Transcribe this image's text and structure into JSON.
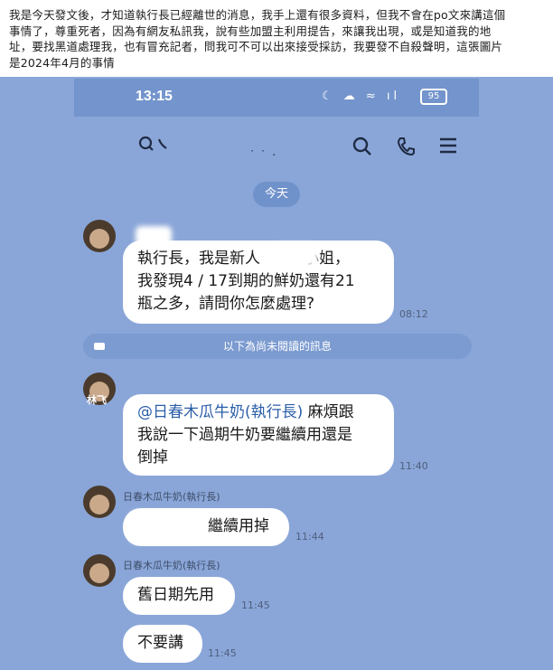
{
  "post": {
    "caption_line1": "我是今天發文後，才知道執行長已經離世的消息，我手上還有很多資料，但我不會在po文來講這個",
    "caption_line2": "事情了，尊重死者，因為有網友私訊我，說有些加盟主利用提告，來讓我出現，或是知道我的地",
    "caption_line3": "址，要找黑道處理我，也有冒充記者，問我可不可以出來接受採訪，我要發不自殺聲明，這張圖片",
    "caption_line4": "是2024年4月的事情"
  },
  "status_bar": {
    "time": "13:15",
    "battery": "95",
    "icons": "☾ ☁ ≈ ıl"
  },
  "header": {
    "name": "ᐧ ᐧ ."
  },
  "date_divider": "今天",
  "messages": [
    {
      "lines": [
        "執行長，我是新人",
        "小姐，",
        "我發現4 / 17到期的鮮奶還有21",
        "瓶之多，請問你怎麼處理?"
      ],
      "time": "08:12"
    },
    {
      "mention": "@日春木瓜牛奶(執行長)",
      "lines": [
        " 麻煩跟",
        "我說一下過期牛奶要繼續用還是",
        "倒掉"
      ],
      "time": "11:40"
    },
    {
      "sender": "日春木瓜牛奶(執行長)",
      "text": "繼續用掉",
      "time": "11:44"
    },
    {
      "sender": "日春木瓜牛奶(執行長)",
      "text": "舊日期先用",
      "time": "11:45"
    },
    {
      "text": "不要講",
      "time": "11:45"
    }
  ],
  "unread_divider": "以下為尚未閱讀的訊息",
  "sender2_label": "林飞"
}
